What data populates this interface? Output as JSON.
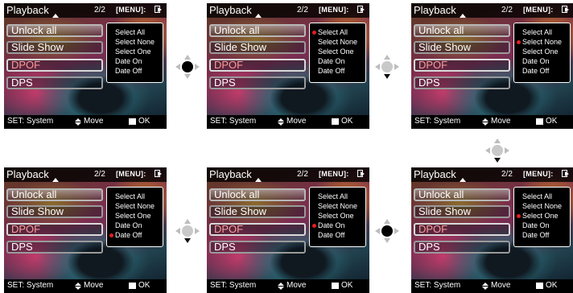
{
  "screens": [
    {
      "id": "s1",
      "title": "Playback",
      "page": "2/2",
      "menu_label": "[MENU]:",
      "items": [
        "Unlock all",
        "Slide Show",
        "DPOF",
        "DPS"
      ],
      "options": [
        "Select All",
        "Select None",
        "Select One",
        "Date On",
        "Date Off"
      ],
      "active_option": -1,
      "footer": {
        "set": "SET: System",
        "move": "Move",
        "ok": "OK"
      }
    },
    {
      "id": "s2",
      "title": "Playback",
      "page": "2/2",
      "menu_label": "[MENU]:",
      "items": [
        "Unlock all",
        "Slide Show",
        "DPOF",
        "DPS"
      ],
      "options": [
        "Select All",
        "Select None",
        "Select One",
        "Date On",
        "Date Off"
      ],
      "active_option": 0,
      "footer": {
        "set": "SET: System",
        "move": "Move",
        "ok": "OK"
      }
    },
    {
      "id": "s3",
      "title": "Playback",
      "page": "2/2",
      "menu_label": "[MENU]:",
      "items": [
        "Unlock all",
        "Slide Show",
        "DPOF",
        "DPS"
      ],
      "options": [
        "Select All",
        "Select None",
        "Select One",
        "Date On",
        "Date Off"
      ],
      "active_option": 1,
      "footer": {
        "set": "SET: System",
        "move": "Move",
        "ok": "OK"
      }
    },
    {
      "id": "s4",
      "title": "Playback",
      "page": "2/2",
      "menu_label": "[MENU]:",
      "items": [
        "Unlock all",
        "Slide Show",
        "DPOF",
        "DPS"
      ],
      "options": [
        "Select All",
        "Select None",
        "Select One",
        "Date On",
        "Date Off"
      ],
      "active_option": 4,
      "footer": {
        "set": "SET: System",
        "move": "Move",
        "ok": "OK"
      }
    },
    {
      "id": "s5",
      "title": "Playback",
      "page": "2/2",
      "menu_label": "[MENU]:",
      "items": [
        "Unlock all",
        "Slide Show",
        "DPOF",
        "DPS"
      ],
      "options": [
        "Select All",
        "Select None",
        "Select One",
        "Date On",
        "Date Off"
      ],
      "active_option": 3,
      "footer": {
        "set": "SET: System",
        "move": "Move",
        "ok": "OK"
      }
    },
    {
      "id": "s6",
      "title": "Playback",
      "page": "2/2",
      "menu_label": "[MENU]:",
      "items": [
        "Unlock all",
        "Slide Show",
        "DPOF",
        "DPS"
      ],
      "options": [
        "Select All",
        "Select None",
        "Select One",
        "Date On",
        "Date Off"
      ],
      "active_option": 2,
      "footer": {
        "set": "SET: System",
        "move": "Move",
        "ok": "OK"
      }
    }
  ],
  "pads": [
    {
      "id": "p1",
      "active": "center"
    },
    {
      "id": "p2",
      "active": "down"
    },
    {
      "id": "p3",
      "active": "down"
    },
    {
      "id": "p4",
      "active": "center"
    },
    {
      "id": "p5",
      "active": "down"
    }
  ],
  "icons": {
    "back": "return-icon",
    "move": "up-down-arrows-icon",
    "ok": "ok-square-icon",
    "nav": "dpad-icon"
  },
  "colors": {
    "option_bullet": "#e02020",
    "dpof_text": "#ff9a9a"
  }
}
